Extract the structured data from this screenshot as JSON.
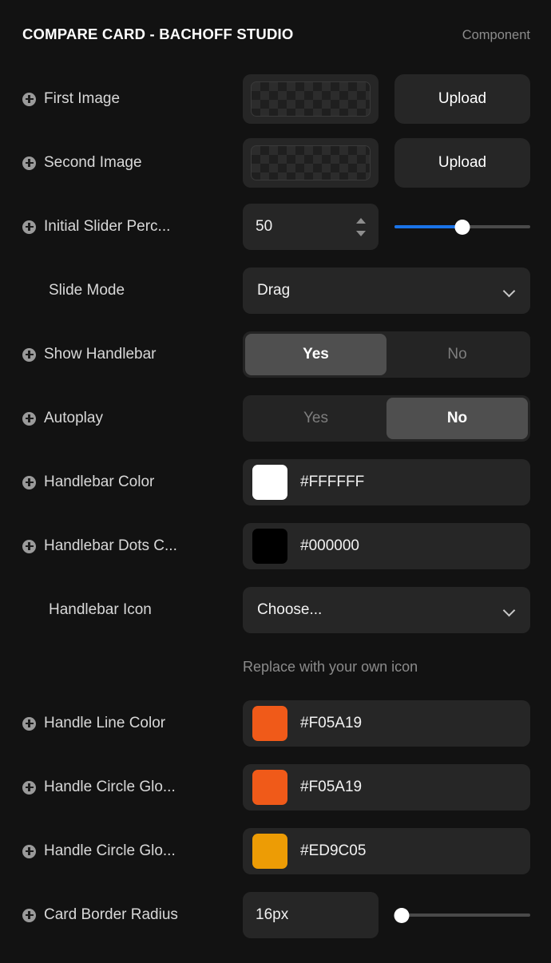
{
  "header": {
    "title": "COMPARE CARD - BACHOFF STUDIO",
    "kind": "Component"
  },
  "rows": {
    "first_image": {
      "label": "First Image",
      "upload_label": "Upload",
      "thumb_icon": "transparency-checkerboard"
    },
    "second_image": {
      "label": "Second Image",
      "upload_label": "Upload",
      "thumb_icon": "transparency-checkerboard"
    },
    "initial_slider_percent": {
      "label": "Initial Slider Perc...",
      "value": "50",
      "slider_percent": 50
    },
    "slide_mode": {
      "label": "Slide Mode",
      "value": "Drag",
      "options": [
        "Drag"
      ]
    },
    "show_handlebar": {
      "label": "Show Handlebar",
      "yes_label": "Yes",
      "no_label": "No",
      "selected": "Yes"
    },
    "autoplay": {
      "label": "Autoplay",
      "yes_label": "Yes",
      "no_label": "No",
      "selected": "No"
    },
    "handlebar_color": {
      "label": "Handlebar Color",
      "hex": "#FFFFFF"
    },
    "handlebar_dots_color": {
      "label": "Handlebar Dots C...",
      "hex": "#000000"
    },
    "handlebar_icon": {
      "label": "Handlebar Icon",
      "value": "Choose...",
      "note": "Replace with your own icon"
    },
    "handle_line_color": {
      "label": "Handle Line Color",
      "hex": "#F05A19"
    },
    "handle_circle_glow_one": {
      "label": "Handle Circle Glo...",
      "hex": "#F05A19"
    },
    "handle_circle_glow_two": {
      "label": "Handle Circle Glo...",
      "hex": "#ED9C05"
    },
    "card_border_radius": {
      "label": "Card Border Radius",
      "value": "16px",
      "slider_percent": 5
    }
  },
  "colors": {
    "panel_background": "#121212",
    "field_background": "#262626",
    "segment_active": "#4F4F4F",
    "slider_accent": "#1A73E8",
    "label_text": "#D8D8D8",
    "muted_text": "#8B8B8B"
  }
}
